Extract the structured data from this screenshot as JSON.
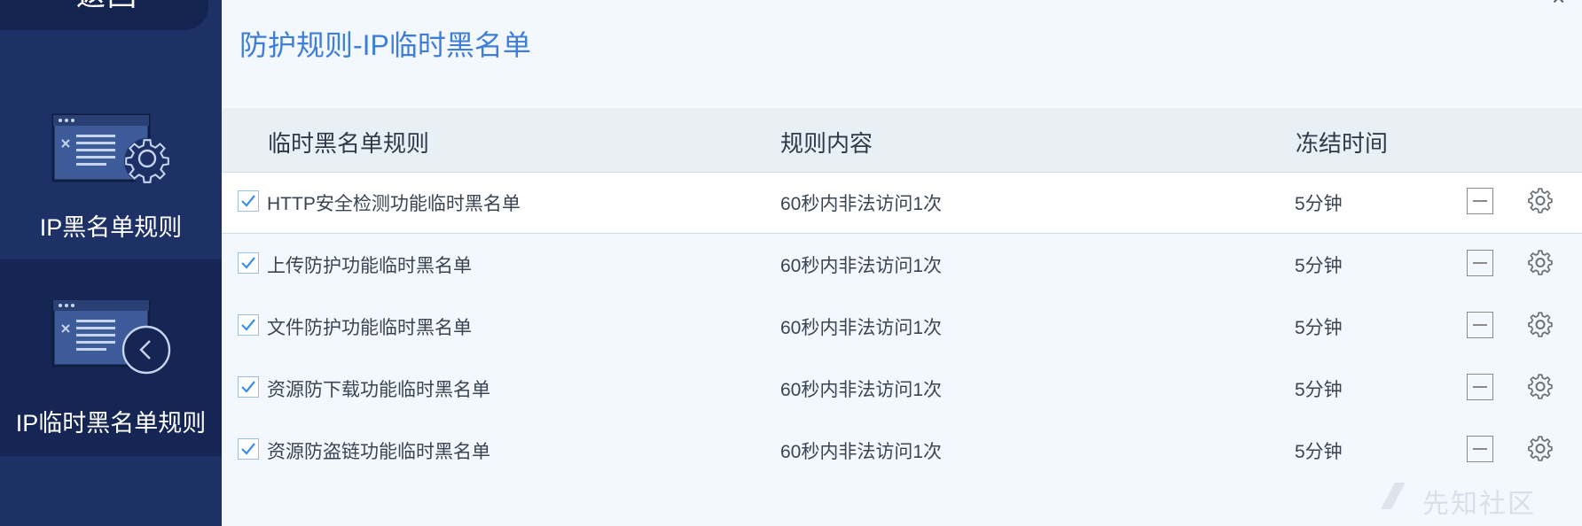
{
  "sidebar": {
    "back_label": "返回",
    "items": [
      {
        "label": "IP黑名单规则",
        "icon": "list-settings-icon"
      },
      {
        "label": "IP临时黑名单规则",
        "icon": "list-back-icon"
      }
    ]
  },
  "page": {
    "title": "防护规则-IP临时黑名单",
    "close": "×"
  },
  "table": {
    "columns": [
      "临时黑名单规则",
      "规则内容",
      "冻结时间"
    ],
    "rows": [
      {
        "checked": true,
        "name": "HTTP安全检测功能临时黑名单",
        "content": "60秒内非法访问1次",
        "time": "5分钟"
      },
      {
        "checked": true,
        "name": "上传防护功能临时黑名单",
        "content": "60秒内非法访问1次",
        "time": "5分钟"
      },
      {
        "checked": true,
        "name": "文件防护功能临时黑名单",
        "content": "60秒内非法访问1次",
        "time": "5分钟"
      },
      {
        "checked": true,
        "name": "资源防下载功能临时黑名单",
        "content": "60秒内非法访问1次",
        "time": "5分钟"
      },
      {
        "checked": true,
        "name": "资源防盗链功能临时黑名单",
        "content": "60秒内非法访问1次",
        "time": "5分钟"
      }
    ]
  },
  "watermark": "先知社区",
  "colors": {
    "sidebar_bg": "#1d3167",
    "sidebar_active_bg": "#152554",
    "title_blue": "#3f7ed6",
    "main_bg": "#f2f8fd",
    "header_bg": "#e8f0f6",
    "check_blue": "#3a8ee6"
  }
}
